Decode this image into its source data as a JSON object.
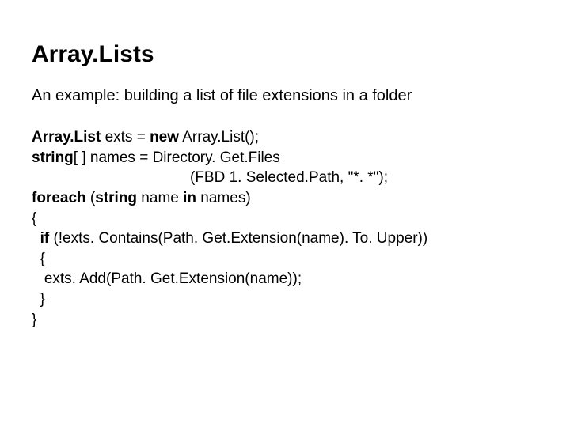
{
  "title": "Array.Lists",
  "subtitle": "An example: building a list of file extensions in a folder",
  "code": {
    "l1a": "Array.List",
    "l1b": " exts = ",
    "l1c": "new",
    "l1d": " Array.List();",
    "l2a": "string",
    "l2b": "[ ] names = Directory. Get.Files",
    "l3": "(FBD 1. Selected.Path, \"*. *\");",
    "l4a": "foreach",
    "l4b": " (",
    "l4c": "string",
    "l4d": " name ",
    "l4e": "in",
    "l4f": " names)",
    "l5": "{",
    "l6a": "  ",
    "l6b": "if",
    "l6c": " (!exts. Contains(Path. Get.Extension(name). To. Upper))",
    "l7": "  {",
    "l8": "   exts. Add(Path. Get.Extension(name));",
    "l9": "  }",
    "l10": "}"
  }
}
